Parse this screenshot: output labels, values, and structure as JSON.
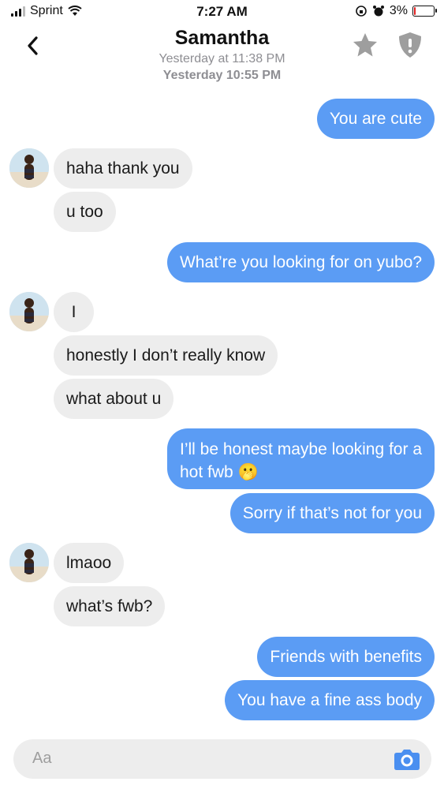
{
  "status": {
    "carrier": "Sprint",
    "time": "7:27 AM",
    "battery": "3%"
  },
  "header": {
    "back_icon": "chevron-left-icon",
    "title": "Samantha",
    "subtitle1": "Yesterday at 11:38 PM",
    "subtitle2": "Yesterday 10:55 PM",
    "star_icon": "star-icon",
    "shield_icon": "shield-icon"
  },
  "messages": [
    {
      "from": "me",
      "text": "You are cute"
    },
    {
      "from": "them",
      "text": "haha thank you"
    },
    {
      "from": "them",
      "text": "u too"
    },
    {
      "from": "me",
      "text": "What’re you looking for on yubo?"
    },
    {
      "from": "them",
      "text": "I"
    },
    {
      "from": "them",
      "text": "honestly I don’t really know"
    },
    {
      "from": "them",
      "text": "what about u"
    },
    {
      "from": "me",
      "text": "I’ll be honest maybe looking for a hot fwb",
      "line1": "I’ll be honest maybe looking for a",
      "line2": "hot fwb",
      "emoji": "🫢"
    },
    {
      "from": "me",
      "text": "Sorry if that’s not for you"
    },
    {
      "from": "them",
      "text": "lmaoo"
    },
    {
      "from": "them",
      "text": "what’s fwb?"
    },
    {
      "from": "me",
      "text": "Friends with benefits"
    },
    {
      "from": "me",
      "text": "You have a fine ass body"
    }
  ],
  "composer": {
    "placeholder": "Aa",
    "camera_icon": "camera-icon"
  },
  "colors": {
    "outgoing": "#5b9cf4",
    "incoming": "#ededed",
    "meta": "#8e8e93"
  }
}
